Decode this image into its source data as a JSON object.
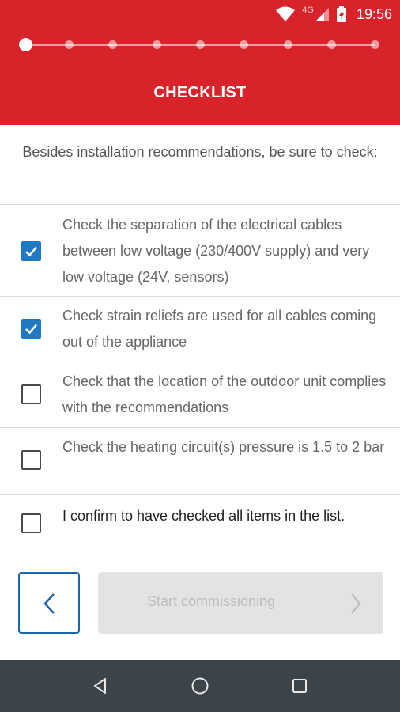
{
  "status_bar": {
    "network_label": "4G",
    "time": "19:56",
    "icons": [
      "wifi-icon",
      "cell-signal-icon",
      "battery-charging-icon"
    ]
  },
  "stepper": {
    "total_steps": 9,
    "current_step": 1
  },
  "header": {
    "title": "CHECKLIST"
  },
  "intro": {
    "text": "Besides installation recommendations, be sure to check:"
  },
  "checklist": {
    "items": [
      {
        "label": "Check the separation of the electrical cables between low voltage (230/400V supply) and very low voltage (24V, sensors)",
        "checked": true
      },
      {
        "label": "Check strain reliefs are used for all cables coming out of the appliance",
        "checked": true
      },
      {
        "label": "Check that the location of the outdoor unit complies with the recommendations",
        "checked": false
      },
      {
        "label": "Check the heating circuit(s) pressure is 1.5 to 2 bar",
        "checked": false
      }
    ]
  },
  "confirm": {
    "label": "I confirm to have checked all items in the list.",
    "checked": false
  },
  "actions": {
    "back_icon": "chevron-left-icon",
    "start_label": "Start commissioning",
    "start_enabled": false,
    "start_icon": "chevron-right-icon"
  },
  "nav_bar": {
    "icons": [
      "back-triangle-icon",
      "home-circle-icon",
      "recents-square-icon"
    ]
  },
  "colors": {
    "brand_red": "#d8232a",
    "checkbox_blue": "#1f78c1",
    "back_button_border": "#1f63a8",
    "disabled_button": "#e3e3e3",
    "nav_bar": "#3d4449"
  }
}
